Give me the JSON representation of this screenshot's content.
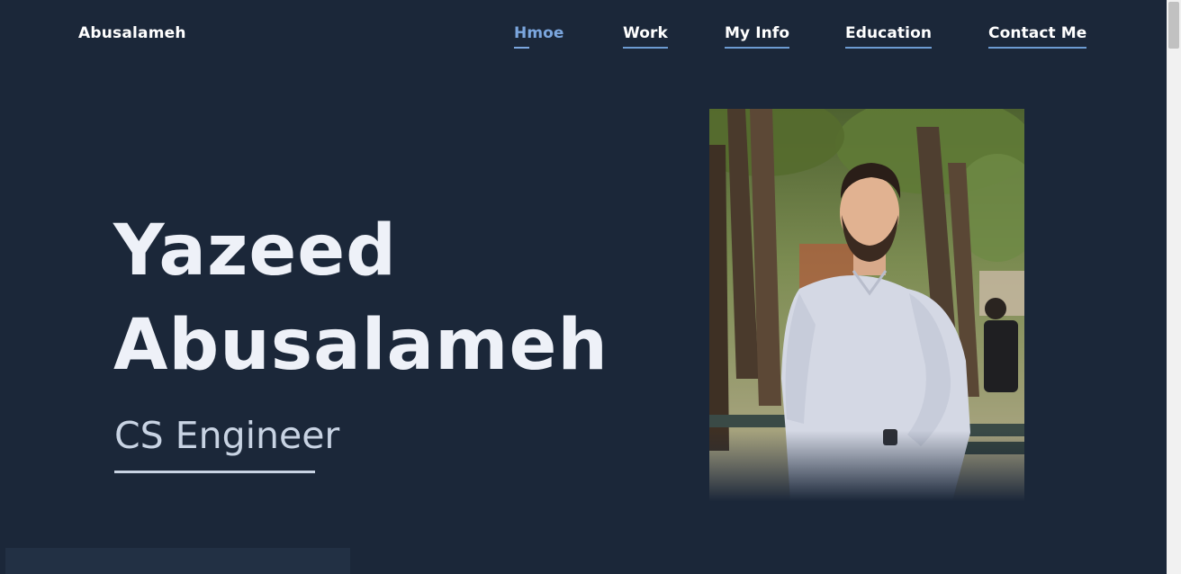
{
  "header": {
    "brand": "Abusalameh",
    "nav": [
      {
        "label": "Hmoe",
        "active": true
      },
      {
        "label": "Work",
        "active": false
      },
      {
        "label": "My Info",
        "active": false
      },
      {
        "label": "Education",
        "active": false
      },
      {
        "label": "Contact Me",
        "active": false
      }
    ]
  },
  "hero": {
    "first_name": "Yazeed",
    "last_name": "Abusalameh",
    "role": "CS Engineer"
  },
  "colors": {
    "background": "#1b2739",
    "accent": "#7ba6de",
    "heading": "#eef1f8",
    "subtitle": "#c8d3e3"
  }
}
